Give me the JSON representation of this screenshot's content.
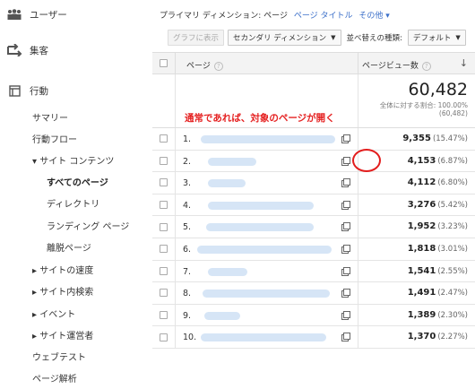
{
  "sidebar": {
    "users": "ユーザー",
    "acquisition": "集客",
    "behavior": "行動",
    "items": [
      {
        "label": "サマリー"
      },
      {
        "label": "行動フロー"
      },
      {
        "label": "▾ サイト コンテンツ"
      },
      {
        "label": "すべてのページ"
      },
      {
        "label": "ディレクトリ"
      },
      {
        "label": "ランディング ページ"
      },
      {
        "label": "離脱ページ"
      },
      {
        "label": "▸ サイトの速度"
      },
      {
        "label": "▸ サイト内検索"
      },
      {
        "label": "▸ イベント"
      },
      {
        "label": "▸ サイト運営者"
      },
      {
        "label": "ウェブテスト"
      },
      {
        "label": "ページ解析"
      }
    ]
  },
  "dims": {
    "primary_label": "プライマリ ディメンション:",
    "page": "ページ",
    "page_title": "ページ タイトル",
    "other": "その他 ▾"
  },
  "toolbar": {
    "graph": "グラフに表示",
    "secondary": "セカンダリ ディメンション",
    "sort_label": "並べ替えの種類:",
    "default": "デフォルト"
  },
  "table": {
    "col_page": "ページ",
    "col_views": "ページビュー数",
    "total": "60,482",
    "total_sub1": "全体に対する割合: 100.00%",
    "total_sub2": "(60,482)",
    "annotation": "通常であれば、対象のページが開く",
    "rows": [
      {
        "rank": "1.",
        "value": "9,355",
        "pct": "(15.47%)"
      },
      {
        "rank": "2.",
        "value": "4,153",
        "pct": "(6.87%)"
      },
      {
        "rank": "3.",
        "value": "4,112",
        "pct": "(6.80%)"
      },
      {
        "rank": "4.",
        "value": "3,276",
        "pct": "(5.42%)"
      },
      {
        "rank": "5.",
        "value": "1,952",
        "pct": "(3.23%)"
      },
      {
        "rank": "6.",
        "value": "1,818",
        "pct": "(3.01%)"
      },
      {
        "rank": "7.",
        "value": "1,541",
        "pct": "(2.55%)"
      },
      {
        "rank": "8.",
        "value": "1,491",
        "pct": "(2.47%)"
      },
      {
        "rank": "9.",
        "value": "1,389",
        "pct": "(2.30%)"
      },
      {
        "rank": "10.",
        "value": "1,370",
        "pct": "(2.27%)"
      }
    ]
  },
  "icons": {
    "users": "people-icon",
    "acquisition": "arrows-icon",
    "behavior": "window-icon",
    "external": "external-link-icon",
    "help": "help-icon",
    "sort": "sort-down-icon"
  },
  "colors": {
    "accent_link": "#3b6fc9",
    "annotation_red": "#e52222"
  }
}
